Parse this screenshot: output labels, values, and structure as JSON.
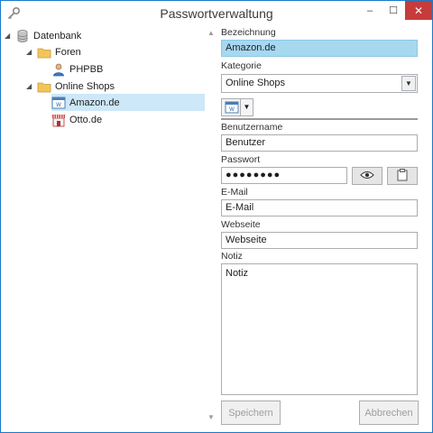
{
  "window": {
    "title": "Passwortverwaltung",
    "minimize_glyph": "–",
    "maximize_glyph": "☐",
    "close_glyph": "✕",
    "app_icon": "key-icon"
  },
  "tree": {
    "root": {
      "label": "Datenbank",
      "icon": "database-icon"
    },
    "groups": [
      {
        "label": "Foren",
        "icon": "folder-icon",
        "children": [
          {
            "label": "PHPBB",
            "icon": "user-icon"
          }
        ]
      },
      {
        "label": "Online Shops",
        "icon": "folder-icon",
        "children": [
          {
            "label": "Amazon.de",
            "icon": "web-window-icon",
            "selected": true
          },
          {
            "label": "Otto.de",
            "icon": "shop-icon",
            "selected": false
          }
        ]
      }
    ]
  },
  "form": {
    "bezeichnung_label": "Bezeichnung",
    "bezeichnung_value": "Amazon.de",
    "kategorie_label": "Kategorie",
    "kategorie_value": "Online Shops",
    "benutzername_label": "Benutzername",
    "benutzername_value": "Benutzer",
    "passwort_label": "Passwort",
    "passwort_value": "●●●●●●●●",
    "email_label": "E-Mail",
    "email_value": "E-Mail",
    "webseite_label": "Webseite",
    "webseite_value": "Webseite",
    "notiz_label": "Notiz",
    "notiz_value": "Notiz",
    "save_label": "Speichern",
    "cancel_label": "Abbrechen"
  },
  "colors": {
    "accent": "#1a7ac8",
    "selection": "#cde8f8",
    "highlight_field": "#a6d8f0",
    "close_button": "#c73b3b"
  }
}
